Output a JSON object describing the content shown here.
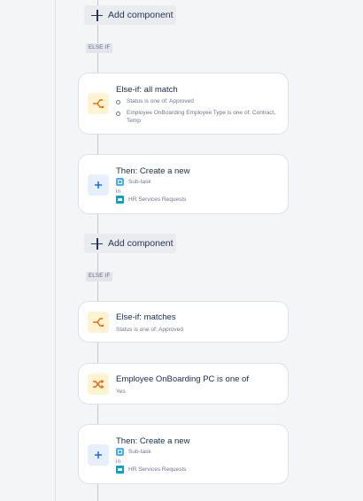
{
  "colors": {
    "accent_blue": "#0c66e4",
    "condition_orange": "#e56910"
  },
  "blocks": {
    "add1_label": "Add component",
    "else1_tag": "ELSE IF",
    "cond1": {
      "title": "Else-if: all match",
      "line1": "Status is one of: Approved",
      "line2": "Employee OnBoarding Employee Type is one of: Contract, Temp"
    },
    "action1": {
      "title": "Then: Create a new",
      "issue_type": "Sub-task",
      "in": "in",
      "project": "HR Services Requests"
    },
    "add2_label": "Add component",
    "else2_tag": "ELSE IF",
    "cond2": {
      "title": "Else-if: matches",
      "line1": "Status is one of: Approved"
    },
    "cond3": {
      "title": "Employee OnBoarding PC is one of",
      "line1": "Yes"
    },
    "action2": {
      "title": "Then: Create a new",
      "issue_type": "Sub-task",
      "in": "in",
      "project": "HR Services Requests"
    }
  }
}
